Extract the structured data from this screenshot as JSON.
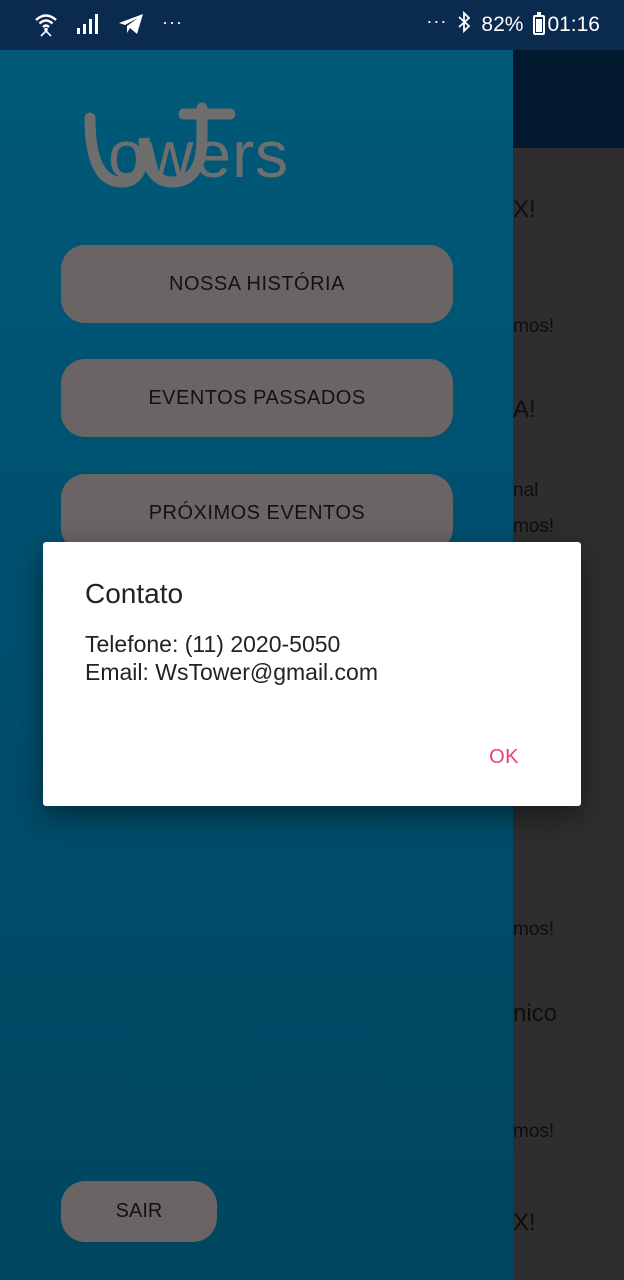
{
  "status_bar": {
    "overflow_left": "···",
    "overflow_right": "···",
    "battery_percent": "82%",
    "time": "01:16",
    "icons": [
      "wifi-icon",
      "signal-icon",
      "telegram-icon",
      "bluetooth-icon",
      "battery-icon"
    ]
  },
  "drawer": {
    "logo_text": "WsTowers",
    "menu": [
      {
        "label": "NOSSA HISTÓRIA"
      },
      {
        "label": "EVENTOS PASSADOS"
      },
      {
        "label": "PRÓXIMOS EVENTOS"
      }
    ],
    "logout_label": "SAIR"
  },
  "background_content": [
    {
      "text": "X!"
    },
    {
      "text": "mos!"
    },
    {
      "text": "A!"
    },
    {
      "text": "nal"
    },
    {
      "text": "mos!"
    },
    {
      "text": "mos!"
    },
    {
      "text": "nico"
    },
    {
      "text": "mos!"
    },
    {
      "text": "X!"
    }
  ],
  "dialog": {
    "title": "Contato",
    "phone_line": "Telefone: (11) 2020-5050",
    "email_line": "Email: WsTower@gmail.com",
    "ok_label": "OK"
  },
  "colors": {
    "drawer_bg": "#005a78",
    "menu_button_bg": "#6a6464",
    "dialog_accent": "#e8407a",
    "status_bar_bg": "#0a2a4e"
  }
}
